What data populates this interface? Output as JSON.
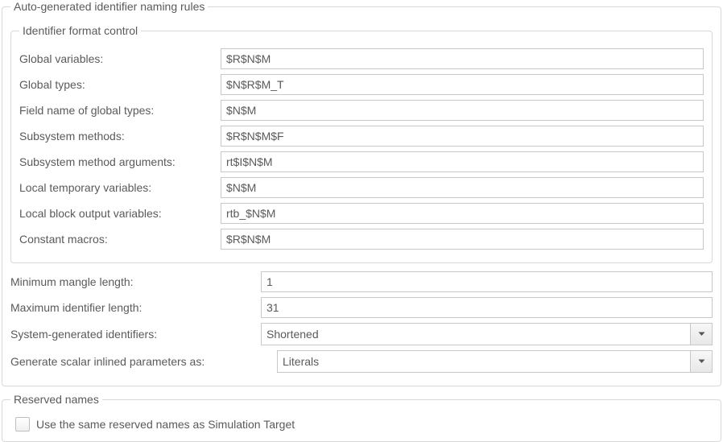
{
  "section_identifier_rules": {
    "legend": "Auto-generated identifier naming rules",
    "format_control": {
      "legend": "Identifier format control",
      "rows": {
        "global_variables": {
          "label": "Global variables:",
          "value": "$R$N$M"
        },
        "global_types": {
          "label": "Global types:",
          "value": "$N$R$M_T"
        },
        "field_name_global_types": {
          "label": "Field name of global types:",
          "value": "$N$M"
        },
        "subsystem_methods": {
          "label": "Subsystem methods:",
          "value": "$R$N$M$F"
        },
        "subsystem_method_args": {
          "label": "Subsystem method arguments:",
          "value": "rt$I$N$M"
        },
        "local_temp_vars": {
          "label": "Local temporary variables:",
          "value": "$N$M"
        },
        "local_block_output_vars": {
          "label": "Local block output variables:",
          "value": "rtb_$N$M"
        },
        "constant_macros": {
          "label": "Constant macros:",
          "value": "$R$N$M"
        }
      }
    },
    "min_mangle_length": {
      "label": "Minimum mangle length:",
      "value": "1"
    },
    "max_identifier_length": {
      "label": "Maximum identifier length:",
      "value": "31"
    },
    "system_generated_identifiers": {
      "label": "System-generated identifiers:",
      "value": "Shortened"
    },
    "generate_scalar_inlined_params": {
      "label": "Generate scalar inlined parameters as:",
      "value": "Literals"
    }
  },
  "section_reserved_names": {
    "legend": "Reserved names",
    "use_same_as_sim_target": {
      "label": "Use the same reserved names as Simulation Target",
      "checked": false
    }
  }
}
